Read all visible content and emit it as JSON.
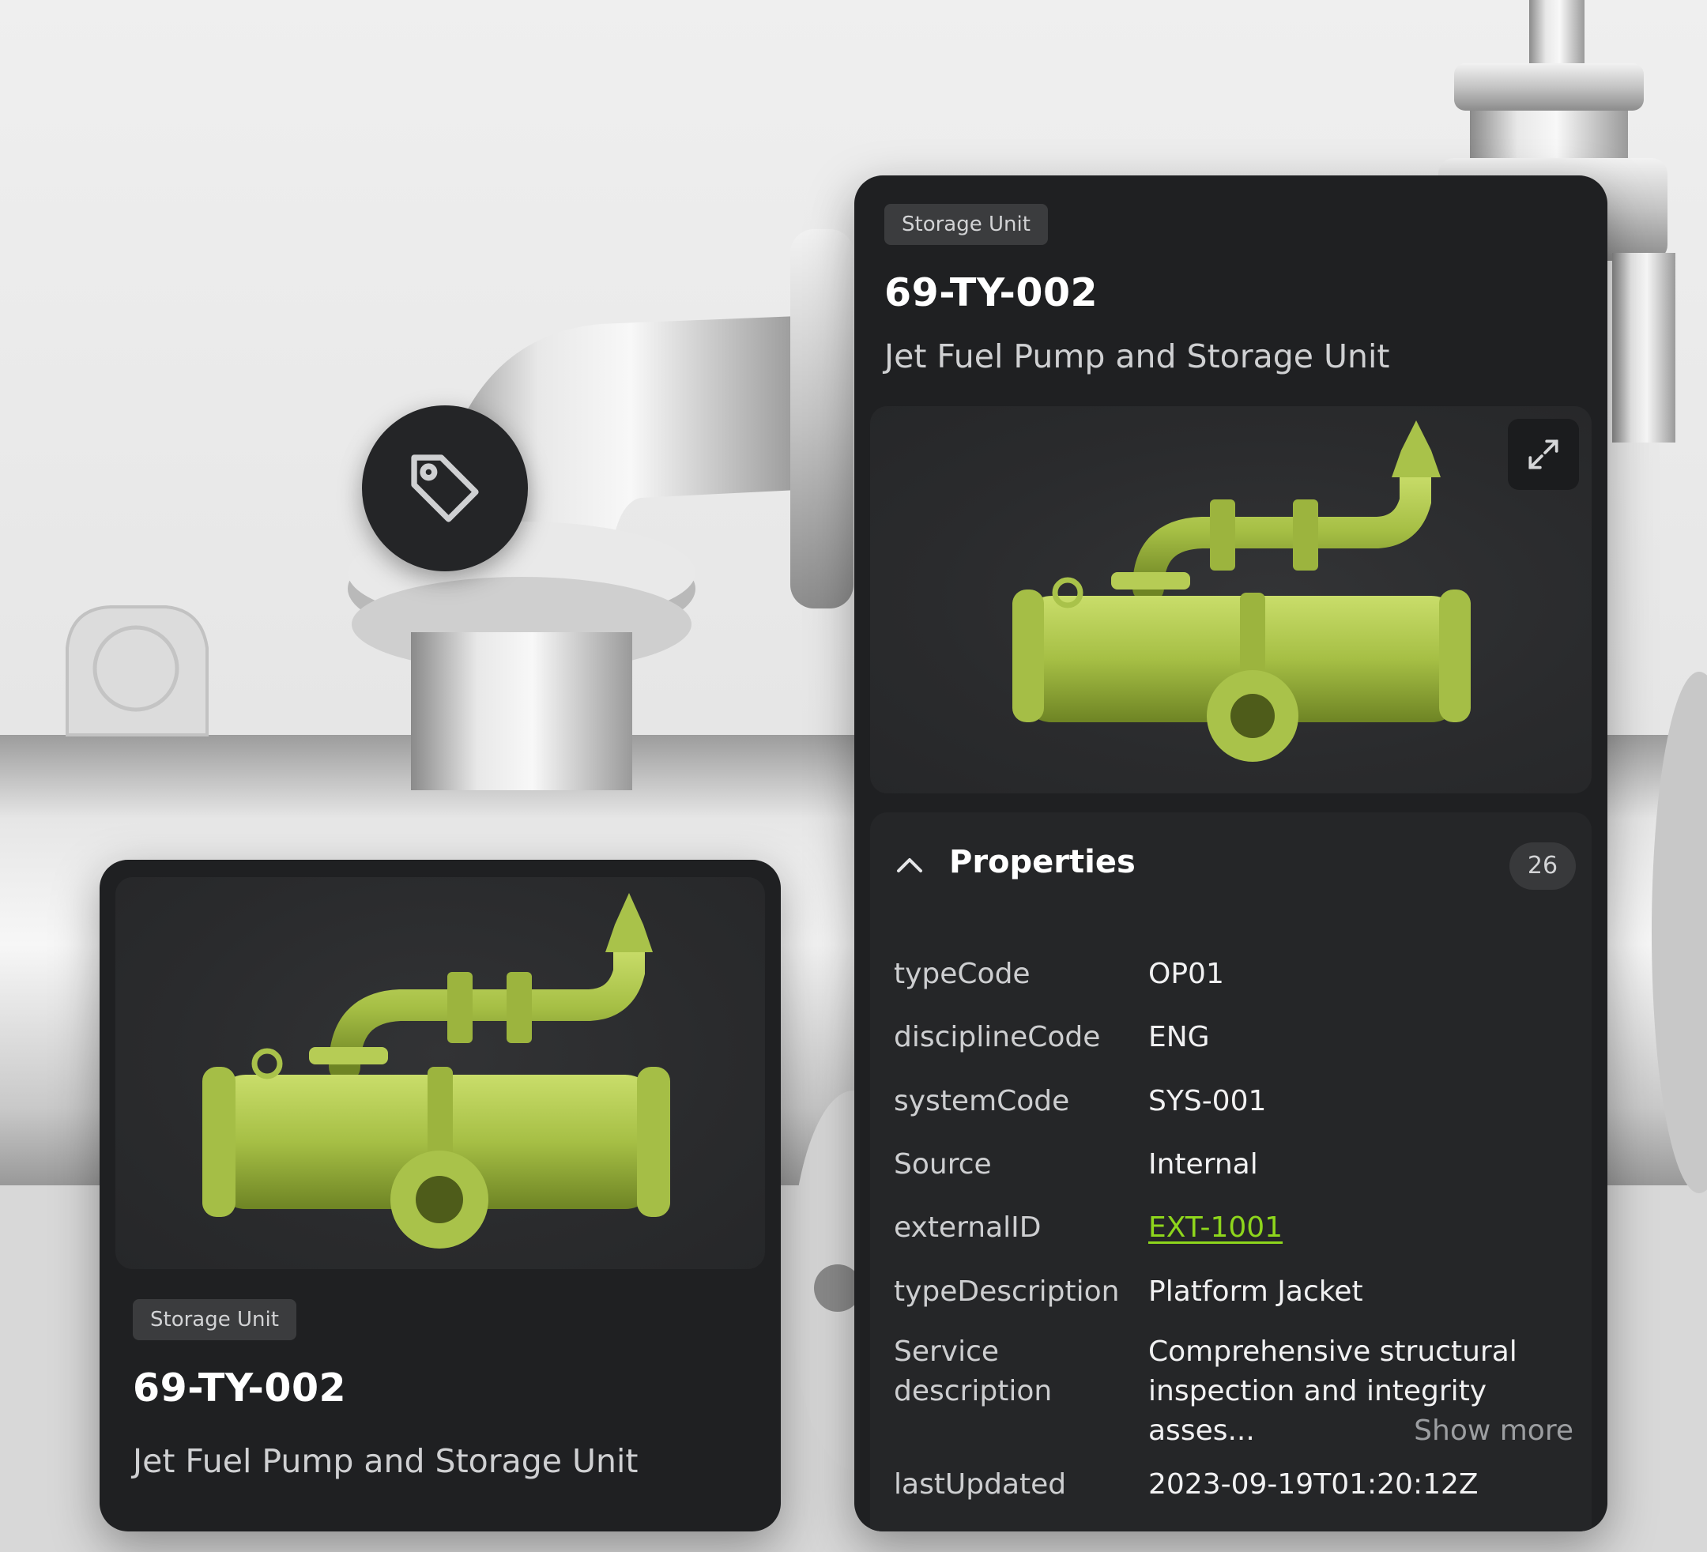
{
  "colors": {
    "accent_green": "#8ed61c",
    "model_green": "#a9c24a",
    "card_bg": "#1f2022"
  },
  "icons": {
    "tag": "tag-icon",
    "expand": "expand-icon",
    "collapse": "chevron-up-icon"
  },
  "small_card": {
    "badge": "Storage Unit",
    "title": "69-TY-002",
    "subtitle": "Jet Fuel Pump and Storage Unit"
  },
  "detail_card": {
    "badge": "Storage Unit",
    "title": "69-TY-002",
    "subtitle": "Jet Fuel Pump and Storage Unit",
    "properties": {
      "heading": "Properties",
      "count": "26",
      "rows": [
        {
          "key": "typeCode",
          "value": "OP01"
        },
        {
          "key": "disciplineCode",
          "value": "ENG"
        },
        {
          "key": "systemCode",
          "value": "SYS-001"
        },
        {
          "key": "Source",
          "value": "Internal"
        },
        {
          "key": "externalID",
          "value": "EXT-1001"
        },
        {
          "key": "typeDescription",
          "value": "Platform Jacket"
        },
        {
          "key": "Service description",
          "value": "Comprehensive structural inspection and integrity asses..."
        },
        {
          "key": "lastUpdated",
          "value": "2023-09-19T01:20:12Z"
        }
      ],
      "show_more": "Show more"
    }
  }
}
